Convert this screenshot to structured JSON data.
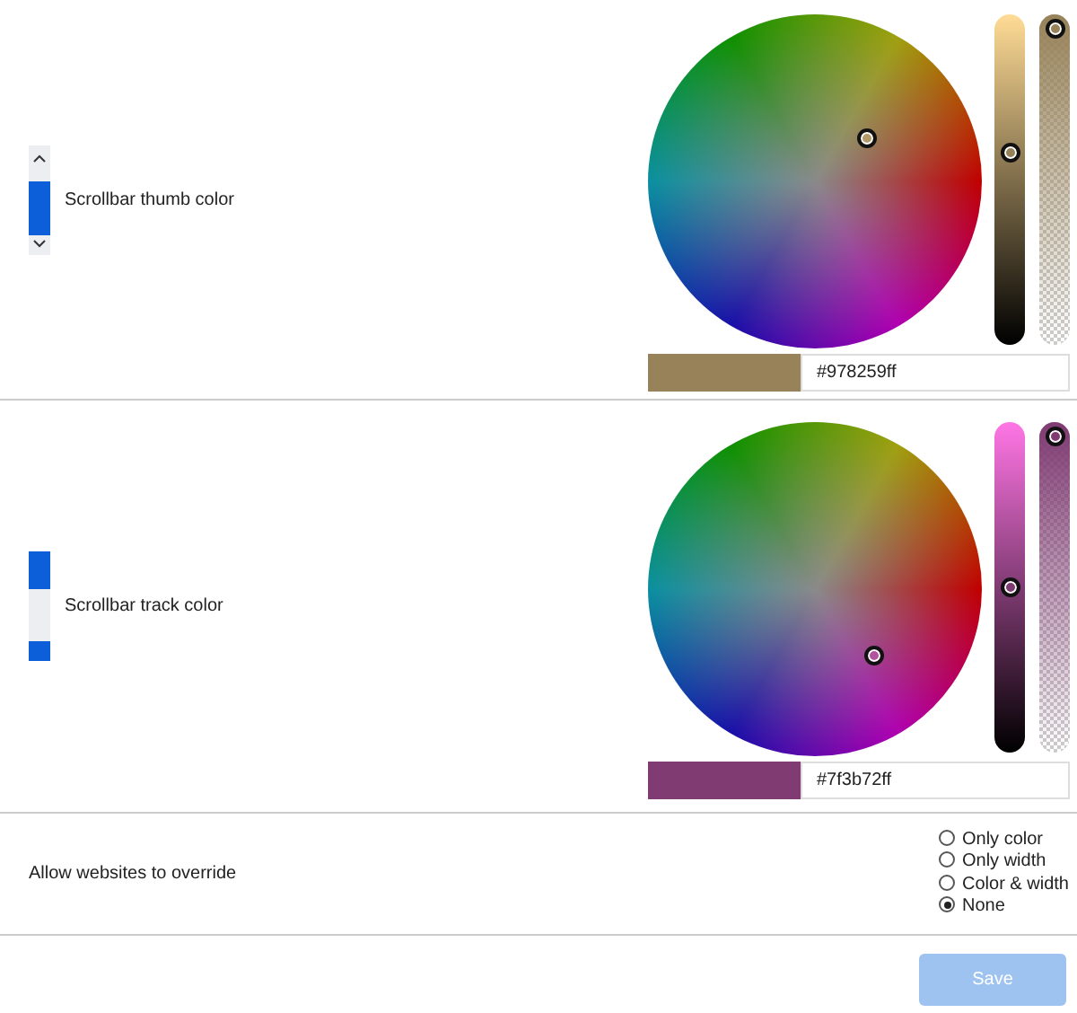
{
  "sections": [
    {
      "kind": "thumb",
      "label": "Scrollbar thumb color",
      "picker": {
        "hex": "#978259ff",
        "brightness": {
          "level": 0.59
        },
        "alpha": {
          "level": 1
        }
      }
    },
    {
      "kind": "track",
      "label": "Scrollbar track color",
      "picker": {
        "hex": "#7f3b72ff",
        "brightness": {
          "level": 0.5
        },
        "alpha": {
          "level": 1
        }
      }
    }
  ],
  "override": {
    "label": "Allow websites to override",
    "options": [
      {
        "label": "Only color",
        "selected": false
      },
      {
        "label": "Only width",
        "selected": false
      },
      {
        "label": "Color & width",
        "selected": false
      },
      {
        "label": "None",
        "selected": true
      }
    ]
  },
  "save": {
    "label": "Save",
    "disabled": true
  }
}
